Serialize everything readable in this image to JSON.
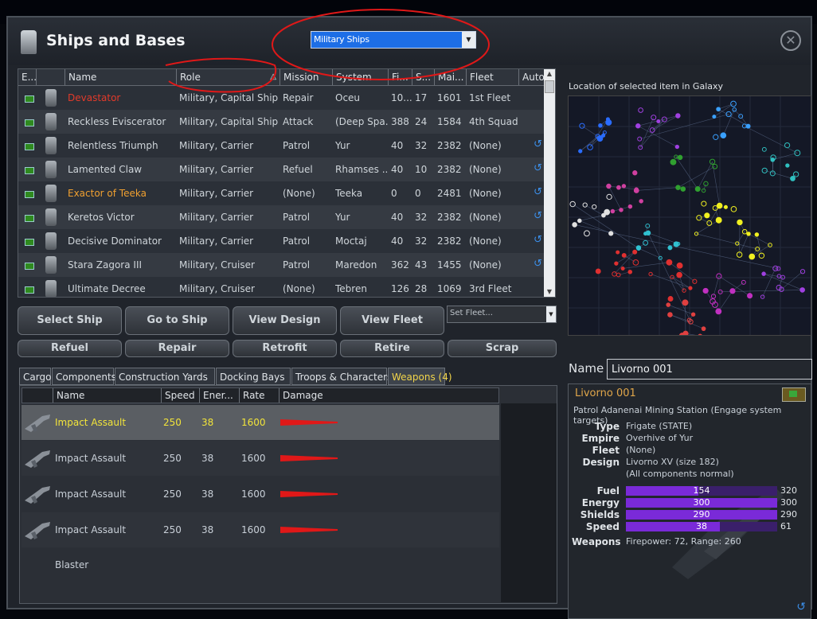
{
  "window": {
    "title": "Ships and Bases",
    "filter_value": "Military Ships",
    "close_icon": "close-icon"
  },
  "table": {
    "columns": [
      "E...",
      "",
      "Name",
      "Role",
      "Mission",
      "System",
      "Fi...",
      "S...",
      "Mai...",
      "Fleet",
      "Auto..."
    ],
    "rows": [
      {
        "name": "Devastator",
        "name_color": "#e23a2a",
        "role": "Military, Capital Ship",
        "mission": "Repair",
        "system": "Oceu",
        "fi": "10...",
        "s": "17",
        "mai": "1601",
        "fleet": "1st Fleet",
        "auto": false
      },
      {
        "name": "Reckless Eviscerator",
        "name_color": "#cfd5da",
        "role": "Military, Capital Ship",
        "mission": "Attack",
        "system": "(Deep Spa...",
        "fi": "388",
        "s": "24",
        "mai": "1584",
        "fleet": "4th Squad...",
        "auto": false
      },
      {
        "name": "Relentless Triumph",
        "name_color": "#cfd5da",
        "role": "Military, Carrier",
        "mission": "Patrol",
        "system": "Yur",
        "fi": "40",
        "s": "32",
        "mai": "2382",
        "fleet": "(None)",
        "auto": true
      },
      {
        "name": "Lamented Claw",
        "name_color": "#cfd5da",
        "role": "Military, Carrier",
        "mission": "Refuel",
        "system": "Rhamses ...",
        "fi": "40",
        "s": "10",
        "mai": "2382",
        "fleet": "(None)",
        "auto": true
      },
      {
        "name": "Exactor of Teeka",
        "name_color": "#f0a030",
        "role": "Military, Carrier",
        "mission": "(None)",
        "system": "Teeka",
        "fi": "0",
        "s": "0",
        "mai": "2481",
        "fleet": "(None)",
        "auto": true
      },
      {
        "name": "Keretos Victor",
        "name_color": "#cfd5da",
        "role": "Military, Carrier",
        "mission": "Patrol",
        "system": "Yur",
        "fi": "40",
        "s": "32",
        "mai": "2382",
        "fleet": "(None)",
        "auto": true
      },
      {
        "name": "Decisive Dominator",
        "name_color": "#cfd5da",
        "role": "Military, Carrier",
        "mission": "Patrol",
        "system": "Moctaj",
        "fi": "40",
        "s": "32",
        "mai": "2382",
        "fleet": "(None)",
        "auto": true
      },
      {
        "name": "Stara Zagora III",
        "name_color": "#cfd5da",
        "role": "Military, Cruiser",
        "mission": "Patrol",
        "system": "Maredon",
        "fi": "362",
        "s": "43",
        "mai": "1455",
        "fleet": "(None)",
        "auto": true
      },
      {
        "name": "Ultimate Decree",
        "name_color": "#cfd5da",
        "role": "Military, Cruiser",
        "mission": "(None)",
        "system": "Tebren",
        "fi": "126",
        "s": "28",
        "mai": "1069",
        "fleet": "3rd Fleet",
        "auto": false
      }
    ]
  },
  "buttons": {
    "select_ship": "Select Ship",
    "go_to_ship": "Go to Ship",
    "view_design": "View Design",
    "view_fleet": "View Fleet",
    "set_fleet": "Set Fleet...",
    "refuel": "Refuel",
    "repair": "Repair",
    "retrofit": "Retrofit",
    "retire": "Retire",
    "scrap": "Scrap"
  },
  "tabs": [
    "Cargo",
    "Components",
    "Construction Yards",
    "Docking Bays",
    "Troops & Characters",
    "Weapons (4)"
  ],
  "weapons": {
    "columns": [
      "",
      "Name",
      "Speed",
      "Ener...",
      "Rate",
      "Damage"
    ],
    "rows": [
      {
        "name": "Impact Assault Blaster",
        "speed": "250",
        "energy": "38",
        "rate": "1600"
      },
      {
        "name": "Impact Assault Blaster",
        "speed": "250",
        "energy": "38",
        "rate": "1600"
      },
      {
        "name": "Impact Assault Blaster",
        "speed": "250",
        "energy": "38",
        "rate": "1600"
      },
      {
        "name": "Impact Assault Blaster",
        "speed": "250",
        "energy": "38",
        "rate": "1600"
      }
    ]
  },
  "map": {
    "label": "Location of selected item in Galaxy"
  },
  "detail": {
    "name_label": "Name",
    "name_value": "Livorno 001",
    "title": "Livorno 001",
    "subtitle": "Patrol Adanenai Mining Station (Engage system targets)",
    "type_label": "Type",
    "type_value": "Frigate (STATE)",
    "empire_label": "Empire",
    "empire_value": "Overhive of Yur",
    "fleet_label": "Fleet",
    "fleet_value": "(None)",
    "design_label": "Design",
    "design_value": "Livorno XV (size 182)",
    "design_note": "(All components normal)",
    "stats": [
      {
        "label": "Fuel",
        "value": "154",
        "max": "320",
        "fraction": 0.48
      },
      {
        "label": "Energy",
        "value": "300",
        "max": "300",
        "fraction": 1.0
      },
      {
        "label": "Shields",
        "value": "290",
        "max": "290",
        "fraction": 1.0
      },
      {
        "label": "Speed",
        "value": "38",
        "max": "61",
        "fraction": 0.62
      }
    ],
    "weapons_label": "Weapons",
    "weapons_value": "Firepower: 72, Range: 260"
  }
}
